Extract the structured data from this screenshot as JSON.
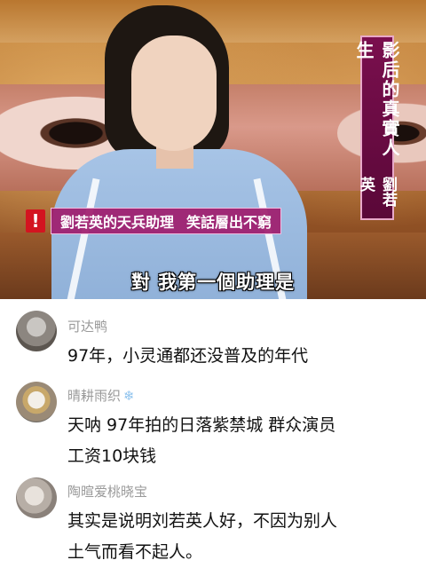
{
  "video": {
    "title_vertical": "影后的真實人生",
    "name_vertical": "劉若英",
    "headline_alert": "!",
    "headline_part1": "劉若英的天兵助理",
    "headline_part2": "笑話層出不窮",
    "subtitle": "對  我第一個助理是"
  },
  "comments": [
    {
      "user": "可达鸭",
      "text": "97年，小灵通都还没普及的年代",
      "badge_icon": ""
    },
    {
      "user": "晴耕雨织",
      "badge_icon": "❄",
      "text_line1": "天呐 97年拍的日落紫禁城 群众演员",
      "text_line2": "工资10块钱"
    },
    {
      "user": "陶暄爱桃晓宝",
      "text_line1": "其实是说明刘若英人好，不因为别人",
      "text_line2": "土气而看不起人。"
    }
  ],
  "colors": {
    "username": "#9a9a9a",
    "comment_text": "#111111",
    "caption_bg": "#a01c6c",
    "title_card_bg": "#7a0f4e",
    "alert_red": "#d31420"
  }
}
